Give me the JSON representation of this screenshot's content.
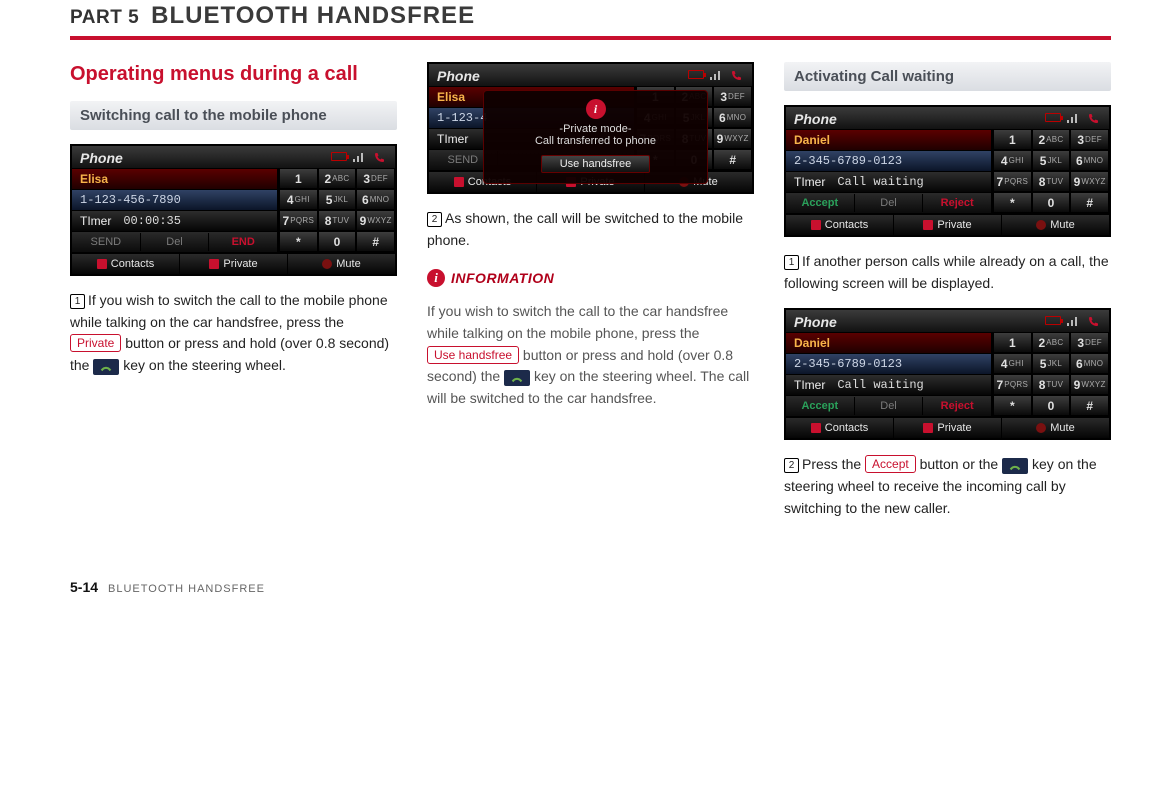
{
  "header": {
    "part_label": "PART 5",
    "part_title": "BLUETOOTH HANDSFREE"
  },
  "footer": {
    "page_number": "5-14",
    "section": "BLUETOOTH HANDSFREE"
  },
  "col1": {
    "section_title": "Operating menus during a call",
    "sub_title": "Switching call to the mobile phone",
    "shot": {
      "title": "Phone",
      "name": "Elisa",
      "number": "1-123-456-7890",
      "timer_label": "TImer",
      "timer_value": "00:00:35",
      "actions": {
        "send": "SEND",
        "del": "Del",
        "end": "END"
      },
      "bottom": {
        "contacts": "Contacts",
        "private": "Private",
        "mute": "Mute"
      }
    },
    "step1_num": "1",
    "step1_a": "If you wish to switch the call to the mobile phone while talking on the car handsfree, press the ",
    "step1_btn": "Private",
    "step1_b": " button or press and hold (over 0.8 second) the ",
    "step1_c": " key on the steering wheel."
  },
  "col2": {
    "shot": {
      "title": "Phone",
      "name": "Elisa",
      "number": "1-123-4",
      "timer_label": "TImer",
      "actions_send": "SEND",
      "overlay": {
        "line1": "-Private mode-",
        "line2": "Call transferred to phone",
        "button": "Use handsfree"
      },
      "bottom": {
        "contacts": "Contacts",
        "private": "Private",
        "mute": "Mute"
      }
    },
    "step2_num": "2",
    "step2_text": "As shown, the call will be switched to the mobile phone.",
    "info_label": "INFORMATION",
    "info_a": "If you wish to switch the call to the car handsfree while talking on the mobile phone, press the ",
    "info_btn": "Use handsfree",
    "info_b": " button or press and hold (over 0.8 second) the ",
    "info_c": " key on the steering wheel. The call will be switched to the car handsfree."
  },
  "col3": {
    "sub_title": "Activating Call waiting",
    "shot": {
      "title": "Phone",
      "name": "Daniel",
      "number": "2-345-6789-0123",
      "timer_label": "TImer",
      "timer_value": "Call waiting",
      "actions": {
        "accept": "Accept",
        "del": "Del",
        "reject": "Reject"
      },
      "bottom": {
        "contacts": "Contacts",
        "private": "Private",
        "mute": "Mute"
      }
    },
    "step1_num": "1",
    "step1_text": "If another person calls while already on a call, the following screen will be displayed.",
    "step2_num": "2",
    "step2_a": "Press the ",
    "step2_btn": "Accept",
    "step2_b": " button or the ",
    "step2_c": " key on the steering wheel to receive the incoming call by switching to the new caller."
  },
  "keypad": [
    {
      "d": "1",
      "l": ""
    },
    {
      "d": "2",
      "l": "ABC"
    },
    {
      "d": "3",
      "l": "DEF"
    },
    {
      "d": "4",
      "l": "GHI"
    },
    {
      "d": "5",
      "l": "JKL"
    },
    {
      "d": "6",
      "l": "MNO"
    },
    {
      "d": "7",
      "l": "PQRS"
    },
    {
      "d": "8",
      "l": "TUV"
    },
    {
      "d": "9",
      "l": "WXYZ"
    },
    {
      "d": "*",
      "l": ""
    },
    {
      "d": "0",
      "l": ""
    },
    {
      "d": "#",
      "l": ""
    }
  ]
}
